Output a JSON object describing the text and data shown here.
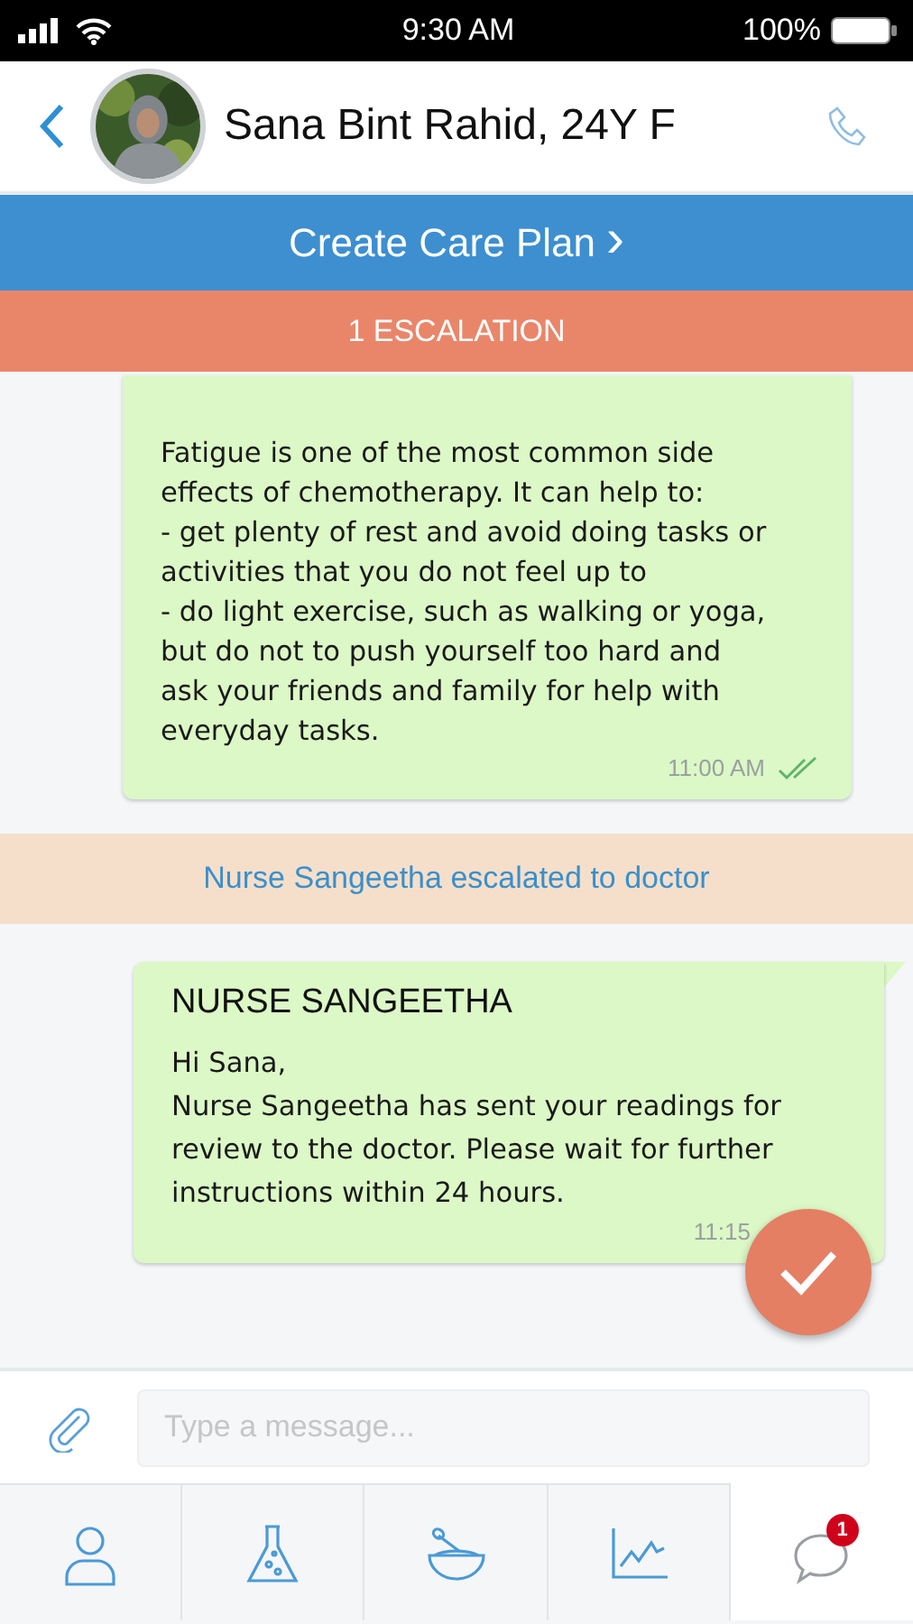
{
  "status_bar": {
    "time": "9:30 AM",
    "battery": "100%"
  },
  "header": {
    "patient": "Sana Bint Rahid, 24Y F"
  },
  "care_plan_button": {
    "label": "Create Care Plan",
    "arrow": "›"
  },
  "escalation_bar": {
    "label": "1 ESCALATION"
  },
  "chat": [
    {
      "kind": "message",
      "text": "Fatigue is one of the most common side effects of chemotherapy. It can help to:\n- get plenty of rest and avoid doing tasks or activities that you do not feel up to\n- do light exercise, such as walking or yoga, but do not to push yourself too hard and ask your friends and family for help with everyday tasks.",
      "time": "11:00 AM",
      "read": true
    },
    {
      "kind": "event",
      "text": "Nurse Sangeetha escalated to doctor"
    },
    {
      "kind": "message",
      "sender": "NURSE SANGEETHA",
      "text": "Hi Sana,\nNurse Sangeetha has sent your readings for review to the doctor. Please wait for further instructions within 24 hours.",
      "time": "11:15"
    }
  ],
  "composer": {
    "placeholder": "Type a message..."
  },
  "tabs": [
    {
      "kind": "profile",
      "selected": false
    },
    {
      "kind": "labs",
      "selected": false
    },
    {
      "kind": "medicine",
      "selected": false
    },
    {
      "kind": "charts",
      "selected": false
    },
    {
      "kind": "chat",
      "selected": true,
      "badge": "1"
    }
  ]
}
